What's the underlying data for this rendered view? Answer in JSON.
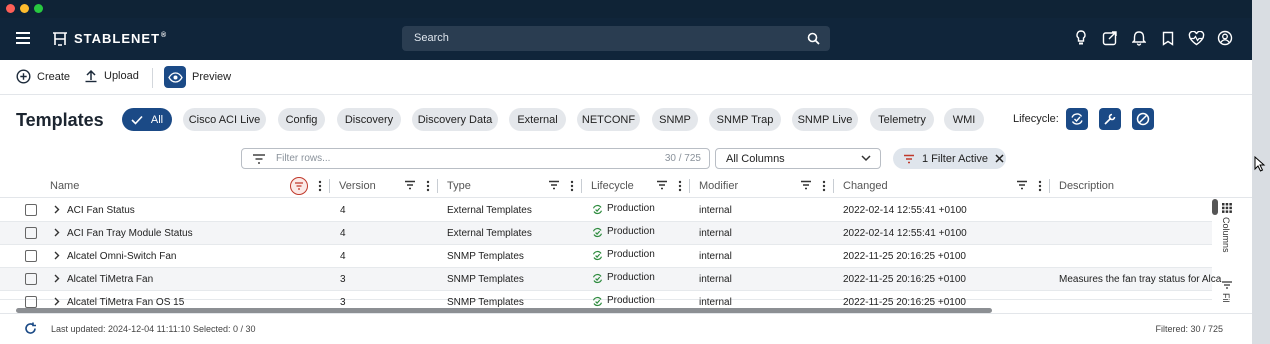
{
  "window": {
    "controls": [
      "close",
      "minimize",
      "zoom"
    ]
  },
  "appbar": {
    "logo_text": "STABLENET",
    "logo_mark": "®",
    "search_placeholder": "Search",
    "icons": [
      "menu-icon",
      "lightbulb-icon",
      "share-icon",
      "bell-icon",
      "bookmark-icon",
      "heart-pulse-icon",
      "user-icon"
    ]
  },
  "toolbar": {
    "create_label": "Create",
    "upload_label": "Upload",
    "preview_label": "Preview"
  },
  "page": {
    "title": "Templates"
  },
  "chips": [
    {
      "label": "All",
      "active": true
    },
    {
      "label": "Cisco ACI Live"
    },
    {
      "label": "Config"
    },
    {
      "label": "Discovery"
    },
    {
      "label": "Discovery Data"
    },
    {
      "label": "External"
    },
    {
      "label": "NETCONF"
    },
    {
      "label": "SNMP"
    },
    {
      "label": "SNMP Trap"
    },
    {
      "label": "SNMP Live"
    },
    {
      "label": "Telemetry"
    },
    {
      "label": "WMI"
    }
  ],
  "lifecycle_label": "Lifecycle:",
  "filter": {
    "placeholder": "Filter rows...",
    "count": "30 / 725",
    "columns_select": "All Columns",
    "active_chip": "1 Filter Active"
  },
  "columns": {
    "name": "Name",
    "version": "Version",
    "type": "Type",
    "lifecycle": "Lifecycle",
    "modifier": "Modifier",
    "changed": "Changed",
    "description": "Description"
  },
  "rows": [
    {
      "name": "ACI Fan Status",
      "version": "4",
      "type": "External Templates",
      "lifecycle": "Production",
      "modifier": "internal",
      "changed": "2022-02-14 12:55:41 +0100",
      "description": ""
    },
    {
      "name": "ACI Fan Tray Module Status",
      "version": "4",
      "type": "External Templates",
      "lifecycle": "Production",
      "modifier": "internal",
      "changed": "2022-02-14 12:55:41 +0100",
      "description": ""
    },
    {
      "name": "Alcatel Omni-Switch Fan",
      "version": "4",
      "type": "SNMP Templates",
      "lifecycle": "Production",
      "modifier": "internal",
      "changed": "2022-11-25 20:16:25 +0100",
      "description": ""
    },
    {
      "name": "Alcatel TiMetra Fan",
      "version": "3",
      "type": "SNMP Templates",
      "lifecycle": "Production",
      "modifier": "internal",
      "changed": "2022-11-25 20:16:25 +0100",
      "description": "Measures the fan tray status for Alca"
    },
    {
      "name": "Alcatel TiMetra Fan OS 15",
      "version": "3",
      "type": "SNMP Templates",
      "lifecycle": "Production",
      "modifier": "internal",
      "changed": "2022-11-25 20:16:25 +0100",
      "description": ""
    }
  ],
  "side_panel": {
    "columns_label": "Columns",
    "filters_label": "Fil"
  },
  "footer": {
    "last_updated": "Last updated: 2024-12-04 11:11:10",
    "selected": "Selected: 0 / 30",
    "filtered": "Filtered: 30 / 725"
  },
  "colors": {
    "appbar": "#10253a",
    "accent": "#1b4a86",
    "chip_bg": "#e4e7eb",
    "production": "#2e8b3e"
  }
}
